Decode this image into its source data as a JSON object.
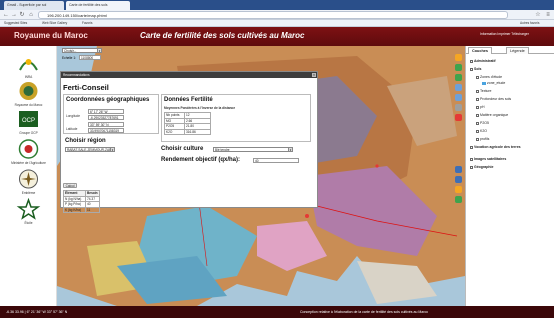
{
  "browser": {
    "tabs": [
      "Gmail - Superficie par sol",
      "Carte de fertilité des sols"
    ],
    "url": "196.200.149.150/carte/map.phtml",
    "bookmarks": [
      "Suggested Sites",
      "Web Slice Gallery",
      "Favoris"
    ],
    "right_bookmark": "Autres favoris"
  },
  "header": {
    "left_title": "Royaume du Maroc",
    "title": "Carte de fertilité des sols cultivés au Maroc",
    "links": "Information  Imprimer  Télécharger"
  },
  "logos": [
    "INRA",
    "Royaume du Maroc",
    "Groupe OCP",
    "Ministère de l'Agriculture",
    "Emblème",
    "Étoile"
  ],
  "map_controls": {
    "choose_label": "Choisir...",
    "scale_label": "Echelle 1:",
    "scale_value": "1108800"
  },
  "popup": {
    "bar_title": "Recommandations",
    "close": "×",
    "heading": "Ferti-Conseil",
    "coords": {
      "title": "Coordonnées géographiques",
      "longitude_label": "Longitude",
      "longitude_dms": "6° 17' 26\" W",
      "longitude_dec": "-6.29023527787691",
      "latitude_label": "Latitude",
      "latitude_dms": "33° 59' 30\" N",
      "latitude_dec": "33.99070671158319"
    },
    "region": {
      "title": "Choisir région",
      "value": "RABAT-SALE-ZEMMOUR-ZAER"
    },
    "fertility": {
      "title": "Données Fertilité",
      "subtitle": "Moyennes Pondérées à l'Inverse de la distance",
      "rows": [
        {
          "label": "Nb points",
          "value": "12"
        },
        {
          "label": "MO",
          "value": "2.66"
        },
        {
          "label": "P2O5",
          "value": "21.80"
        },
        {
          "label": "K2O",
          "value": "316.86"
        }
      ]
    },
    "culture": {
      "label": "Choisir culture",
      "value": "Blé tendre"
    },
    "rendement": {
      "label": "Rendement objectif (qx/ha):",
      "value": "40"
    },
    "calc_button": "Calcul",
    "besoins": {
      "headers": [
        "Élément",
        "Besoin"
      ],
      "rows": [
        [
          "N (kg N/ha)",
          "74.37"
        ],
        [
          "P (kg P/ha)",
          "40"
        ],
        [
          "K (kg K/ha)",
          "11"
        ]
      ]
    }
  },
  "right_panel": {
    "tabs": [
      "Couches",
      "Légende"
    ],
    "tree": [
      {
        "label": "Administratif",
        "bold": true
      },
      {
        "label": "Sols",
        "bold": true
      },
      {
        "label": "Zones d'étude",
        "bold": false
      },
      {
        "label": "zone_etude",
        "bold": false
      },
      {
        "label": "Texture",
        "bold": false
      },
      {
        "label": "Profondeur des sols",
        "bold": false
      },
      {
        "label": "pH",
        "bold": false
      },
      {
        "label": "Matière organique",
        "bold": false
      },
      {
        "label": "P2O5",
        "bold": false
      },
      {
        "label": "K2O",
        "bold": false
      },
      {
        "label": "profils",
        "bold": false
      },
      {
        "label": "Vocation agricole des terres",
        "bold": true
      },
      {
        "label": "Images satellitaires",
        "bold": true
      },
      {
        "label": "Géographie",
        "bold": true
      }
    ]
  },
  "status": {
    "coords": "-6.36 33.96 | 6° 21' 36\" W  33° 57' 36\" N",
    "credit": "Conception relative à l'élaboration de la carte de fertilité des sols cultivés au Maroc"
  },
  "colors": {
    "header": "#7e1113",
    "status": "#3b0709",
    "map_water": "#a7c5d9"
  }
}
